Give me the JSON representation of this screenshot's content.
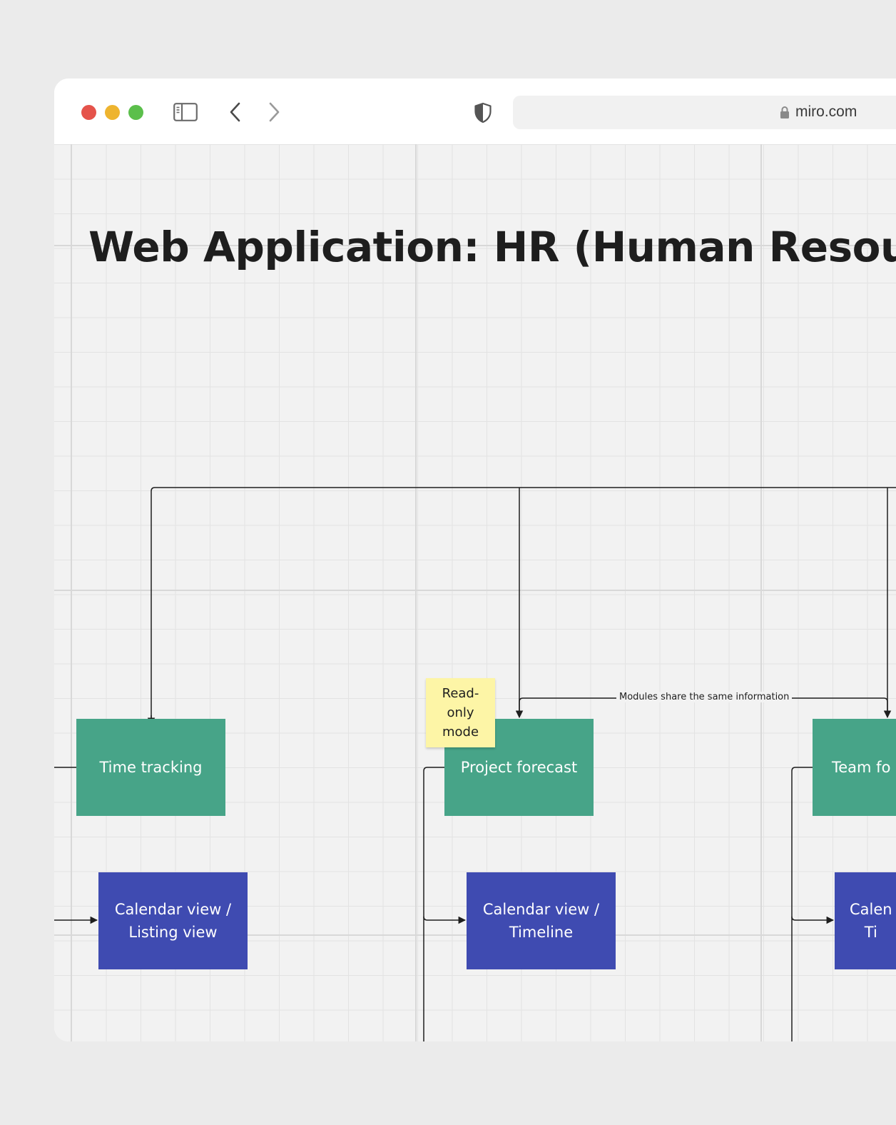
{
  "browser": {
    "url": "miro.com",
    "colors": {
      "close": "#e5534b",
      "minimize": "#eeb42f",
      "zoom": "#5bbf4b"
    },
    "icons": [
      "sidebar-icon",
      "back-icon",
      "forward-icon",
      "shield-icon",
      "lock-icon"
    ]
  },
  "board": {
    "title": "Web Application: HR (Human Resour",
    "sticky_note": "Read-\nonly\nmode",
    "connector_label": "Modules share the same information",
    "modules": [
      {
        "label": "Time tracking",
        "color": "#47a488"
      },
      {
        "label": "Project forecast",
        "color": "#47a488"
      },
      {
        "label": "Team fo",
        "color": "#47a488"
      }
    ],
    "views": [
      {
        "label": "Calendar view /\nListing view",
        "color": "#3f4bb1"
      },
      {
        "label": "Calendar view /\nTimeline",
        "color": "#3f4bb1"
      },
      {
        "label": "Calen\nTi",
        "color": "#3f4bb1"
      }
    ]
  }
}
